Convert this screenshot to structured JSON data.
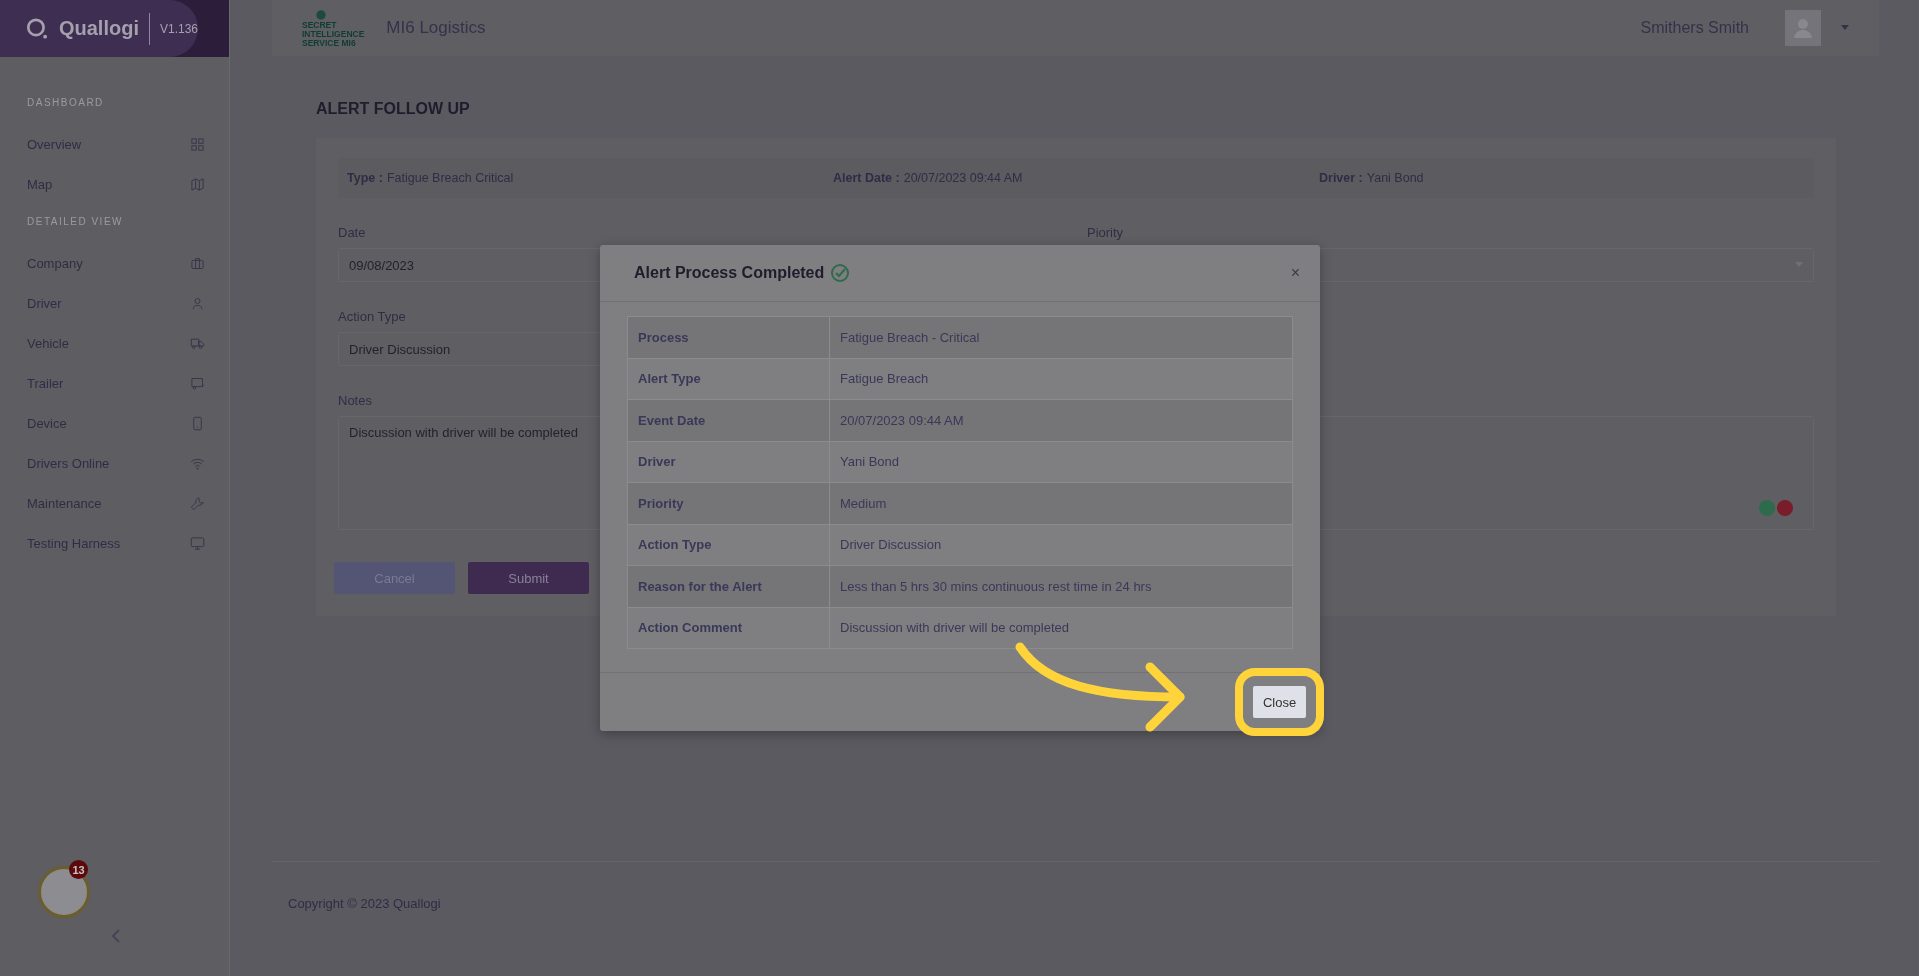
{
  "brand": {
    "name": "Quallogi",
    "version": "V1.136"
  },
  "sidebar": {
    "sections": [
      {
        "heading": "DASHBOARD",
        "items": [
          {
            "label": "Overview"
          },
          {
            "label": "Map"
          }
        ]
      },
      {
        "heading": "DETAILED VIEW",
        "items": [
          {
            "label": "Company"
          },
          {
            "label": "Driver"
          },
          {
            "label": "Vehicle"
          },
          {
            "label": "Trailer"
          },
          {
            "label": "Device"
          },
          {
            "label": "Drivers Online"
          },
          {
            "label": "Maintenance"
          },
          {
            "label": "Testing Harness"
          }
        ]
      }
    ],
    "assistant_badge": "13"
  },
  "topbar": {
    "logo_lines": [
      "SECRET",
      "INTELLIGENCE",
      "SERVICE MI6"
    ],
    "company": "MI6 Logistics",
    "user": "Smithers Smith"
  },
  "page": {
    "title": "ALERT FOLLOW UP",
    "summary": [
      {
        "label": "Type :",
        "value": "Fatigue Breach Critical"
      },
      {
        "label": "Alert Date :",
        "value": "20/07/2023 09:44 AM"
      },
      {
        "label": "Driver :",
        "value": "Yani Bond"
      }
    ],
    "date": {
      "label": "Date",
      "value": "09/08/2023"
    },
    "priority": {
      "label": "Piority"
    },
    "action_type": {
      "label": "Action Type",
      "value": "Driver Discussion"
    },
    "notes": {
      "label": "Notes",
      "value": "Discussion with driver will be completed"
    },
    "buttons": [
      {
        "label": "Cancel",
        "kind": "secondary"
      },
      {
        "label": "Submit",
        "kind": "primary"
      }
    ]
  },
  "modal": {
    "title": "Alert Process Completed",
    "close_icon": "×",
    "rows": [
      {
        "label": "Process",
        "value": "Fatigue Breach - Critical"
      },
      {
        "label": "Alert Type",
        "value": "Fatigue Breach"
      },
      {
        "label": "Event Date",
        "value": "20/07/2023 09:44 AM"
      },
      {
        "label": "Driver",
        "value": "Yani Bond"
      },
      {
        "label": "Priority",
        "value": "Medium"
      },
      {
        "label": "Action Type",
        "value": "Driver Discussion"
      },
      {
        "label": "Reason for the Alert",
        "value": "Less than 5 hrs 30 mins continuous rest time in 24 hrs"
      },
      {
        "label": "Action Comment",
        "value": "Discussion with driver will be completed"
      }
    ],
    "button": "Close"
  },
  "footer": {
    "copyright": "Copyright © 2023 Quallogi"
  }
}
